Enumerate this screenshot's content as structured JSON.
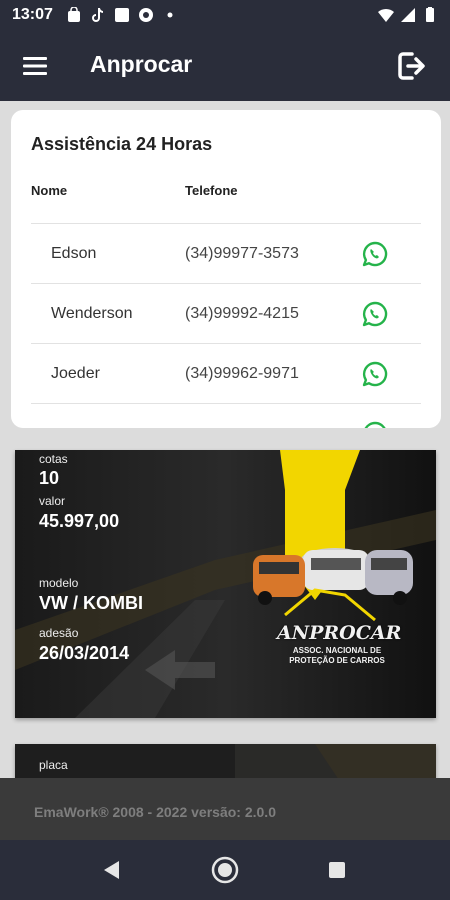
{
  "status_bar": {
    "time": "13:07"
  },
  "app_bar": {
    "title": "Anprocar"
  },
  "assistance": {
    "title": "Assistência 24 Horas",
    "col_name": "Nome",
    "col_phone": "Telefone",
    "contacts": [
      {
        "name": "Edson",
        "phone": "(34)99977-3573"
      },
      {
        "name": "Wenderson",
        "phone": "(34)99992-4215"
      },
      {
        "name": "Joeder",
        "phone": "(34)99962-9971"
      }
    ]
  },
  "vehicle_card": {
    "cotas_label": "cotas",
    "cotas": "10",
    "valor_label": "valor",
    "valor": "45.997,00",
    "modelo_label": "modelo",
    "modelo": "VW / KOMBI",
    "adesao_label": "adesão",
    "adesao": "26/03/2014",
    "logo_text": "ANPROCAR",
    "logo_subtext": "ASSOC. NACIONAL DE PROTEÇÃO DE CARROS"
  },
  "second_card": {
    "placa_label": "placa"
  },
  "footer": {
    "text": "EmaWork® 2008 - 2022 versão: 2.0.0"
  },
  "colors": {
    "bar": "#2a2d3a",
    "whatsapp": "#25b34a",
    "accent": "#f2d600",
    "footer": "#3a3a3a"
  },
  "icons": [
    "menu-icon",
    "logout-icon",
    "whatsapp-icon",
    "back-icon",
    "home-icon",
    "recents-icon"
  ]
}
